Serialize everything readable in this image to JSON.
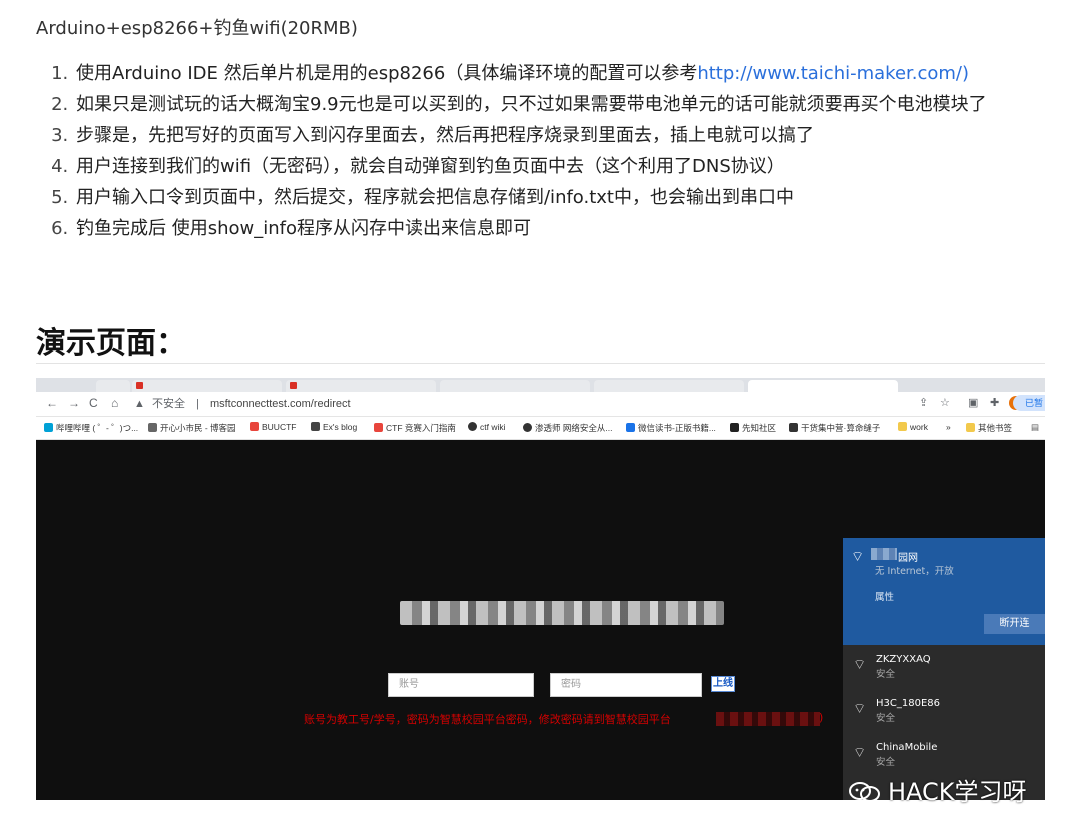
{
  "article": {
    "title_line": "Arduino+esp8266+钓鱼wifi(20RMB)",
    "steps": [
      {
        "text": "使用Arduino IDE 然后单片机是用的esp8266（具体编译环境的配置可以参考",
        "link": "http://www.taichi-maker.com/)"
      },
      {
        "text": "如果只是测试玩的话大概淘宝9.9元也是可以买到的，只不过如果需要带电池单元的话可能就须要再买个电池模块了"
      },
      {
        "text": "步骤是，先把写好的页面写入到闪存里面去，然后再把程序烧录到里面去，插上电就可以搞了"
      },
      {
        "text": "用户连接到我们的wifi（无密码），就会自动弹窗到钓鱼页面中去（这个利用了DNS协议）"
      },
      {
        "text": "用户输入口令到页面中，然后提交，程序就会把信息存储到/info.txt中，也会输出到串口中"
      },
      {
        "text": "钓鱼完成后 使用show_info程序从闪存中读出来信息即可"
      }
    ],
    "demo_heading": "演示页面："
  },
  "browser": {
    "nav": {
      "back": "←",
      "forward": "→",
      "reload": "C",
      "home": "⌂"
    },
    "address": {
      "warning_icon": "▲",
      "security_label": "不安全",
      "separator": "|",
      "url": "msftconnecttest.com/redirect"
    },
    "profile_label": "已暂",
    "bookmarks": [
      {
        "label": "哔哩哔哩 ( ゜- ゜)つ...",
        "color": "#00a1d6"
      },
      {
        "label": "开心小市民 - 博客园",
        "color": "#666666"
      },
      {
        "label": "BUUCTF",
        "color": "#e8453c"
      },
      {
        "label": "Ex's blog",
        "color": "#444444"
      },
      {
        "label": "CTF 竞赛入门指南",
        "color": "#e8453c"
      },
      {
        "label": "ctf wiki",
        "color": "#333333"
      },
      {
        "label": "渗透师 网络安全从...",
        "color": "#333333"
      },
      {
        "label": "微信读书-正版书籍...",
        "color": "#1a73e8"
      },
      {
        "label": "先知社区",
        "color": "#222222"
      },
      {
        "label": "干货集中营·算命缝子",
        "color": "#333333"
      },
      {
        "label": "work",
        "color": "#f2c94c"
      },
      {
        "label": "»",
        "color": ""
      },
      {
        "label": "其他书签",
        "color": "#f2c94c"
      }
    ]
  },
  "portal": {
    "account_placeholder": "账号",
    "password_placeholder": "密码",
    "submit_label": "上线",
    "notice": "账号为教工号/学号，密码为智慧校园平台密码，修改密码请到智慧校园平台",
    "notice_end": ")"
  },
  "wifi": {
    "connected": {
      "name_suffix": "园网",
      "status": "无 Internet，开放",
      "properties": "属性",
      "disconnect": "断开连"
    },
    "networks": [
      {
        "name": "ZKZYXXAQ",
        "status": "安全"
      },
      {
        "name": "H3C_180E86",
        "status": "安全"
      },
      {
        "name": "ChinaMobile",
        "status": "安全"
      }
    ]
  },
  "watermark": {
    "text": "HACK学习呀"
  }
}
